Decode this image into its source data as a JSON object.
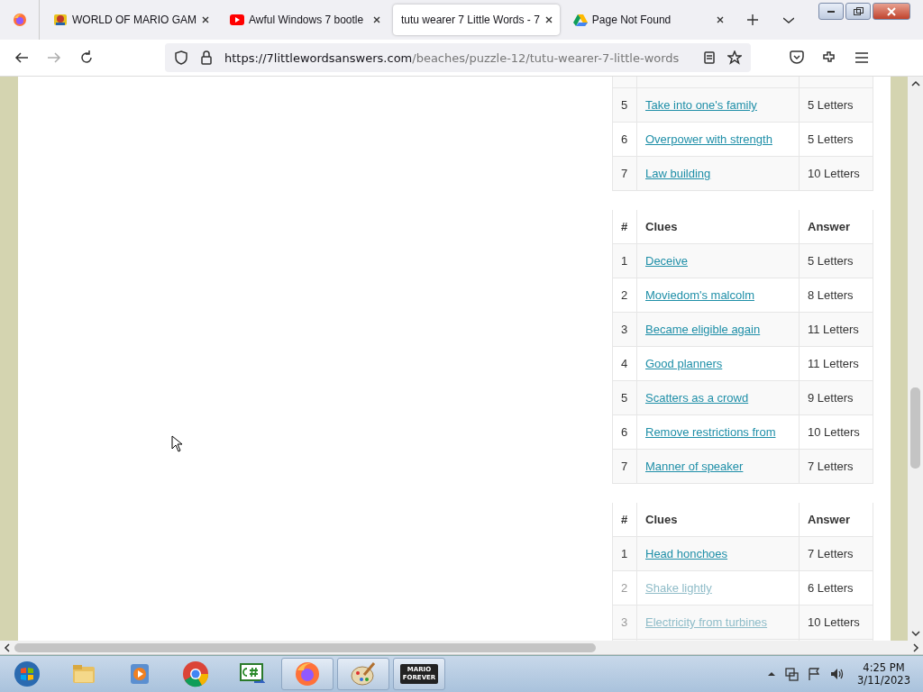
{
  "browser_tabs": [
    {
      "title": "WORLD OF MARIO GAM",
      "selected": false
    },
    {
      "title": "Awful Windows 7 bootle",
      "selected": false
    },
    {
      "title": "tutu wearer 7 Little Words - 7",
      "selected": true
    },
    {
      "title": "Page Not Found",
      "selected": false
    }
  ],
  "address_bar": {
    "domain": "https://7littlewordsanswers.com",
    "path": "/beaches/puzzle-12/tutu-wearer-7-little-words"
  },
  "tables": [
    {
      "rows": [
        {
          "number": "5",
          "clue": "Take into one's family",
          "answer": "5 Letters",
          "faded": false
        },
        {
          "number": "6",
          "clue": "Overpower with strength",
          "answer": "5 Letters",
          "faded": false
        },
        {
          "number": "7",
          "clue": "Law building",
          "answer": "10 Letters",
          "faded": false
        }
      ]
    },
    {
      "header": {
        "number": "#",
        "clue": "Clues",
        "answer": "Answer"
      },
      "rows": [
        {
          "number": "1",
          "clue": "Deceive",
          "answer": "5 Letters",
          "faded": false
        },
        {
          "number": "2",
          "clue": "Moviedom's malcolm",
          "answer": "8 Letters",
          "faded": false
        },
        {
          "number": "3",
          "clue": "Became eligible again",
          "answer": "11 Letters",
          "faded": false
        },
        {
          "number": "4",
          "clue": "Good planners",
          "answer": "11 Letters",
          "faded": false
        },
        {
          "number": "5",
          "clue": "Scatters as a crowd",
          "answer": "9 Letters",
          "faded": false
        },
        {
          "number": "6",
          "clue": "Remove restrictions from",
          "answer": "10 Letters",
          "faded": false
        },
        {
          "number": "7",
          "clue": "Manner of speaker",
          "answer": "7 Letters",
          "faded": false
        }
      ]
    },
    {
      "header": {
        "number": "#",
        "clue": "Clues",
        "answer": "Answer"
      },
      "rows": [
        {
          "number": "1",
          "clue": "Head honchoes",
          "answer": "7 Letters",
          "faded": false
        },
        {
          "number": "2",
          "clue": "Shake lightly",
          "answer": "6 Letters",
          "faded": true
        },
        {
          "number": "3",
          "clue": "Electricity from turbines",
          "answer": "10 Letters",
          "faded": true
        }
      ]
    }
  ],
  "taskbar": {
    "apps": [
      {
        "kind": "start",
        "active": false
      },
      {
        "kind": "folder",
        "active": false
      },
      {
        "kind": "media",
        "active": false
      },
      {
        "kind": "chrome",
        "active": false
      },
      {
        "kind": "csharp",
        "active": false
      },
      {
        "kind": "firefox",
        "active": true
      },
      {
        "kind": "paint",
        "active": true
      },
      {
        "kind": "mario",
        "active": true,
        "label_top": "MARIO",
        "label_bottom": "FOREVER"
      }
    ],
    "time": "4:25 PM",
    "date": "3/11/2023"
  }
}
